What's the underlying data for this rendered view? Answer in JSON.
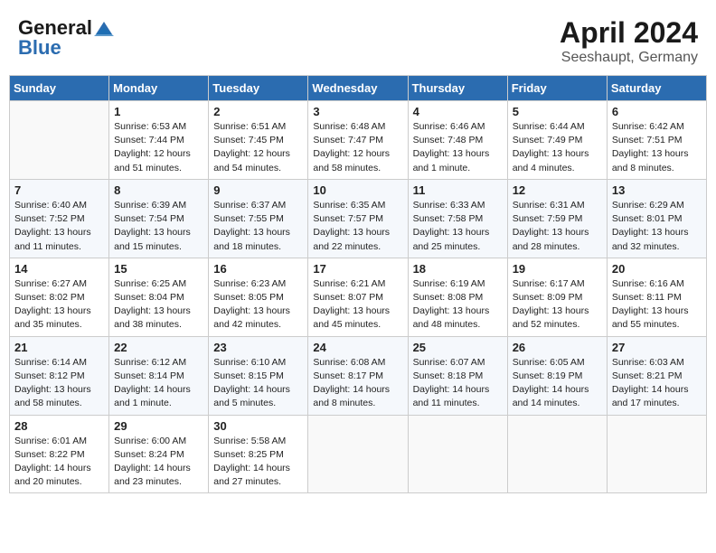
{
  "header": {
    "logo_line1": "General",
    "logo_line2": "Blue",
    "title": "April 2024",
    "subtitle": "Seeshaupt, Germany"
  },
  "weekdays": [
    "Sunday",
    "Monday",
    "Tuesday",
    "Wednesday",
    "Thursday",
    "Friday",
    "Saturday"
  ],
  "weeks": [
    [
      {
        "day": "",
        "info": ""
      },
      {
        "day": "1",
        "info": "Sunrise: 6:53 AM\nSunset: 7:44 PM\nDaylight: 12 hours\nand 51 minutes."
      },
      {
        "day": "2",
        "info": "Sunrise: 6:51 AM\nSunset: 7:45 PM\nDaylight: 12 hours\nand 54 minutes."
      },
      {
        "day": "3",
        "info": "Sunrise: 6:48 AM\nSunset: 7:47 PM\nDaylight: 12 hours\nand 58 minutes."
      },
      {
        "day": "4",
        "info": "Sunrise: 6:46 AM\nSunset: 7:48 PM\nDaylight: 13 hours\nand 1 minute."
      },
      {
        "day": "5",
        "info": "Sunrise: 6:44 AM\nSunset: 7:49 PM\nDaylight: 13 hours\nand 4 minutes."
      },
      {
        "day": "6",
        "info": "Sunrise: 6:42 AM\nSunset: 7:51 PM\nDaylight: 13 hours\nand 8 minutes."
      }
    ],
    [
      {
        "day": "7",
        "info": "Sunrise: 6:40 AM\nSunset: 7:52 PM\nDaylight: 13 hours\nand 11 minutes."
      },
      {
        "day": "8",
        "info": "Sunrise: 6:39 AM\nSunset: 7:54 PM\nDaylight: 13 hours\nand 15 minutes."
      },
      {
        "day": "9",
        "info": "Sunrise: 6:37 AM\nSunset: 7:55 PM\nDaylight: 13 hours\nand 18 minutes."
      },
      {
        "day": "10",
        "info": "Sunrise: 6:35 AM\nSunset: 7:57 PM\nDaylight: 13 hours\nand 22 minutes."
      },
      {
        "day": "11",
        "info": "Sunrise: 6:33 AM\nSunset: 7:58 PM\nDaylight: 13 hours\nand 25 minutes."
      },
      {
        "day": "12",
        "info": "Sunrise: 6:31 AM\nSunset: 7:59 PM\nDaylight: 13 hours\nand 28 minutes."
      },
      {
        "day": "13",
        "info": "Sunrise: 6:29 AM\nSunset: 8:01 PM\nDaylight: 13 hours\nand 32 minutes."
      }
    ],
    [
      {
        "day": "14",
        "info": "Sunrise: 6:27 AM\nSunset: 8:02 PM\nDaylight: 13 hours\nand 35 minutes."
      },
      {
        "day": "15",
        "info": "Sunrise: 6:25 AM\nSunset: 8:04 PM\nDaylight: 13 hours\nand 38 minutes."
      },
      {
        "day": "16",
        "info": "Sunrise: 6:23 AM\nSunset: 8:05 PM\nDaylight: 13 hours\nand 42 minutes."
      },
      {
        "day": "17",
        "info": "Sunrise: 6:21 AM\nSunset: 8:07 PM\nDaylight: 13 hours\nand 45 minutes."
      },
      {
        "day": "18",
        "info": "Sunrise: 6:19 AM\nSunset: 8:08 PM\nDaylight: 13 hours\nand 48 minutes."
      },
      {
        "day": "19",
        "info": "Sunrise: 6:17 AM\nSunset: 8:09 PM\nDaylight: 13 hours\nand 52 minutes."
      },
      {
        "day": "20",
        "info": "Sunrise: 6:16 AM\nSunset: 8:11 PM\nDaylight: 13 hours\nand 55 minutes."
      }
    ],
    [
      {
        "day": "21",
        "info": "Sunrise: 6:14 AM\nSunset: 8:12 PM\nDaylight: 13 hours\nand 58 minutes."
      },
      {
        "day": "22",
        "info": "Sunrise: 6:12 AM\nSunset: 8:14 PM\nDaylight: 14 hours\nand 1 minute."
      },
      {
        "day": "23",
        "info": "Sunrise: 6:10 AM\nSunset: 8:15 PM\nDaylight: 14 hours\nand 5 minutes."
      },
      {
        "day": "24",
        "info": "Sunrise: 6:08 AM\nSunset: 8:17 PM\nDaylight: 14 hours\nand 8 minutes."
      },
      {
        "day": "25",
        "info": "Sunrise: 6:07 AM\nSunset: 8:18 PM\nDaylight: 14 hours\nand 11 minutes."
      },
      {
        "day": "26",
        "info": "Sunrise: 6:05 AM\nSunset: 8:19 PM\nDaylight: 14 hours\nand 14 minutes."
      },
      {
        "day": "27",
        "info": "Sunrise: 6:03 AM\nSunset: 8:21 PM\nDaylight: 14 hours\nand 17 minutes."
      }
    ],
    [
      {
        "day": "28",
        "info": "Sunrise: 6:01 AM\nSunset: 8:22 PM\nDaylight: 14 hours\nand 20 minutes."
      },
      {
        "day": "29",
        "info": "Sunrise: 6:00 AM\nSunset: 8:24 PM\nDaylight: 14 hours\nand 23 minutes."
      },
      {
        "day": "30",
        "info": "Sunrise: 5:58 AM\nSunset: 8:25 PM\nDaylight: 14 hours\nand 27 minutes."
      },
      {
        "day": "",
        "info": ""
      },
      {
        "day": "",
        "info": ""
      },
      {
        "day": "",
        "info": ""
      },
      {
        "day": "",
        "info": ""
      }
    ]
  ]
}
